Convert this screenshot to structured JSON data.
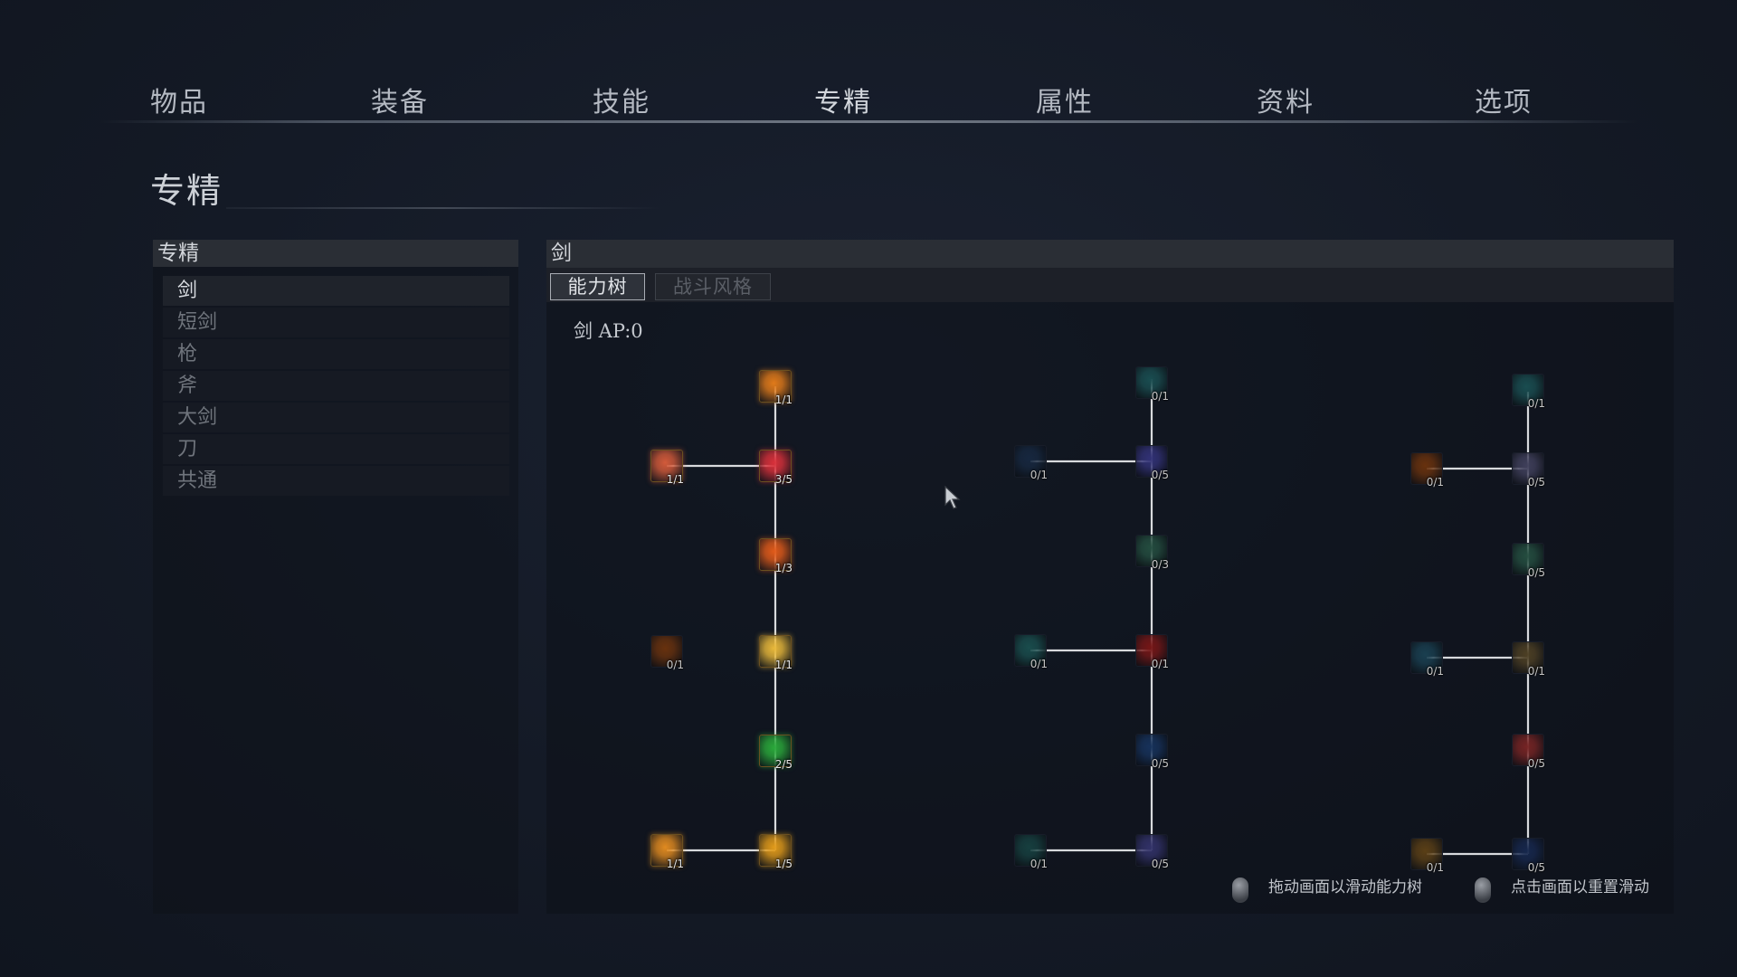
{
  "nav": {
    "tabs": [
      {
        "label": "物品"
      },
      {
        "label": "装备"
      },
      {
        "label": "技能"
      },
      {
        "label": "专精"
      },
      {
        "label": "属性"
      },
      {
        "label": "资料"
      },
      {
        "label": "选项"
      }
    ],
    "active_index": 3
  },
  "page_title": "专精",
  "left_panel": {
    "header": "专精",
    "categories": [
      {
        "label": "剑"
      },
      {
        "label": "短剑"
      },
      {
        "label": "枪"
      },
      {
        "label": "斧"
      },
      {
        "label": "大剑"
      },
      {
        "label": "刀"
      },
      {
        "label": "共通"
      }
    ],
    "active_index": 0
  },
  "right_panel": {
    "header": "剑",
    "tabs": {
      "ability_tree": "能力树",
      "combat_style": "战斗风格"
    },
    "ap_label": "剑 AP:0"
  },
  "tree": {
    "nodes": [
      {
        "id": "a1",
        "rank": "1/1",
        "icon": "flame-sword-slash-icon",
        "color": "#e07a1a"
      },
      {
        "id": "a2",
        "rank": "1/1",
        "icon": "fire-claw-icon",
        "color": "#d25a3a"
      },
      {
        "id": "a3",
        "rank": "3/5",
        "icon": "crimson-blade-icon",
        "color": "#d8303a"
      },
      {
        "id": "a4",
        "rank": "1/3",
        "icon": "piercing-thrust-icon",
        "color": "#e05a1a"
      },
      {
        "id": "a5",
        "rank": "0/1",
        "icon": "fire-pillar-icon",
        "color": "#7a3a10"
      },
      {
        "id": "a6",
        "rank": "1/1",
        "icon": "golden-crystal-icon",
        "color": "#e8b83a"
      },
      {
        "id": "a7",
        "rank": "2/5",
        "icon": "green-target-icon",
        "color": "#2aa83a"
      },
      {
        "id": "a8",
        "rank": "1/1",
        "icon": "sword-flurry-icon",
        "color": "#e08a20"
      },
      {
        "id": "a9",
        "rank": "1/5",
        "icon": "flame-burst-icon",
        "color": "#e09a1a"
      },
      {
        "id": "b1",
        "rank": "0/1",
        "icon": "teal-wave-icon",
        "color": "#1e5a5e"
      },
      {
        "id": "b2",
        "rank": "0/1",
        "icon": "shadow-slash-icon",
        "color": "#1a2e4a"
      },
      {
        "id": "b3",
        "rank": "0/5",
        "icon": "arcane-star-icon",
        "color": "#3a3a8a"
      },
      {
        "id": "b4",
        "rank": "0/3",
        "icon": "green-serpent-icon",
        "color": "#2a5a4a"
      },
      {
        "id": "b5",
        "rank": "0/1",
        "icon": "teal-beast-icon",
        "color": "#1e5a5a"
      },
      {
        "id": "b6",
        "rank": "0/1",
        "icon": "red-dragon-icon",
        "color": "#8a1a1a"
      },
      {
        "id": "b7",
        "rank": "0/5",
        "icon": "blue-fang-icon",
        "color": "#1a3a6a"
      },
      {
        "id": "b8",
        "rank": "0/1",
        "icon": "teal-spike-icon",
        "color": "#1a4a4a"
      },
      {
        "id": "b9",
        "rank": "0/5",
        "icon": "violet-burst-icon",
        "color": "#3a3a7a"
      },
      {
        "id": "c1",
        "rank": "0/1",
        "icon": "teal-crest-icon",
        "color": "#1e5a5e"
      },
      {
        "id": "c2",
        "rank": "0/1",
        "icon": "bronze-ring-icon",
        "color": "#7a3a10"
      },
      {
        "id": "c3",
        "rank": "0/5",
        "icon": "grey-spirit-icon",
        "color": "#4a4a6a"
      },
      {
        "id": "c4",
        "rank": "0/5",
        "icon": "green-crest-icon",
        "color": "#2a5a4a"
      },
      {
        "id": "c5",
        "rank": "0/1",
        "icon": "teal-helm-icon",
        "color": "#1e4a5e"
      },
      {
        "id": "c6",
        "rank": "0/1",
        "icon": "bronze-shade-icon",
        "color": "#5a4a2a"
      },
      {
        "id": "c7",
        "rank": "0/5",
        "icon": "red-cross-icon",
        "color": "#8a2a2a"
      },
      {
        "id": "c8",
        "rank": "0/1",
        "icon": "amber-glow-icon",
        "color": "#6a4a1a"
      },
      {
        "id": "c9",
        "rank": "0/5",
        "icon": "blue-spike-icon",
        "color": "#1a2e5a"
      }
    ]
  },
  "hints": {
    "drag": "拖动画面以滑动能力树",
    "click": "点击画面以重置滑动"
  }
}
